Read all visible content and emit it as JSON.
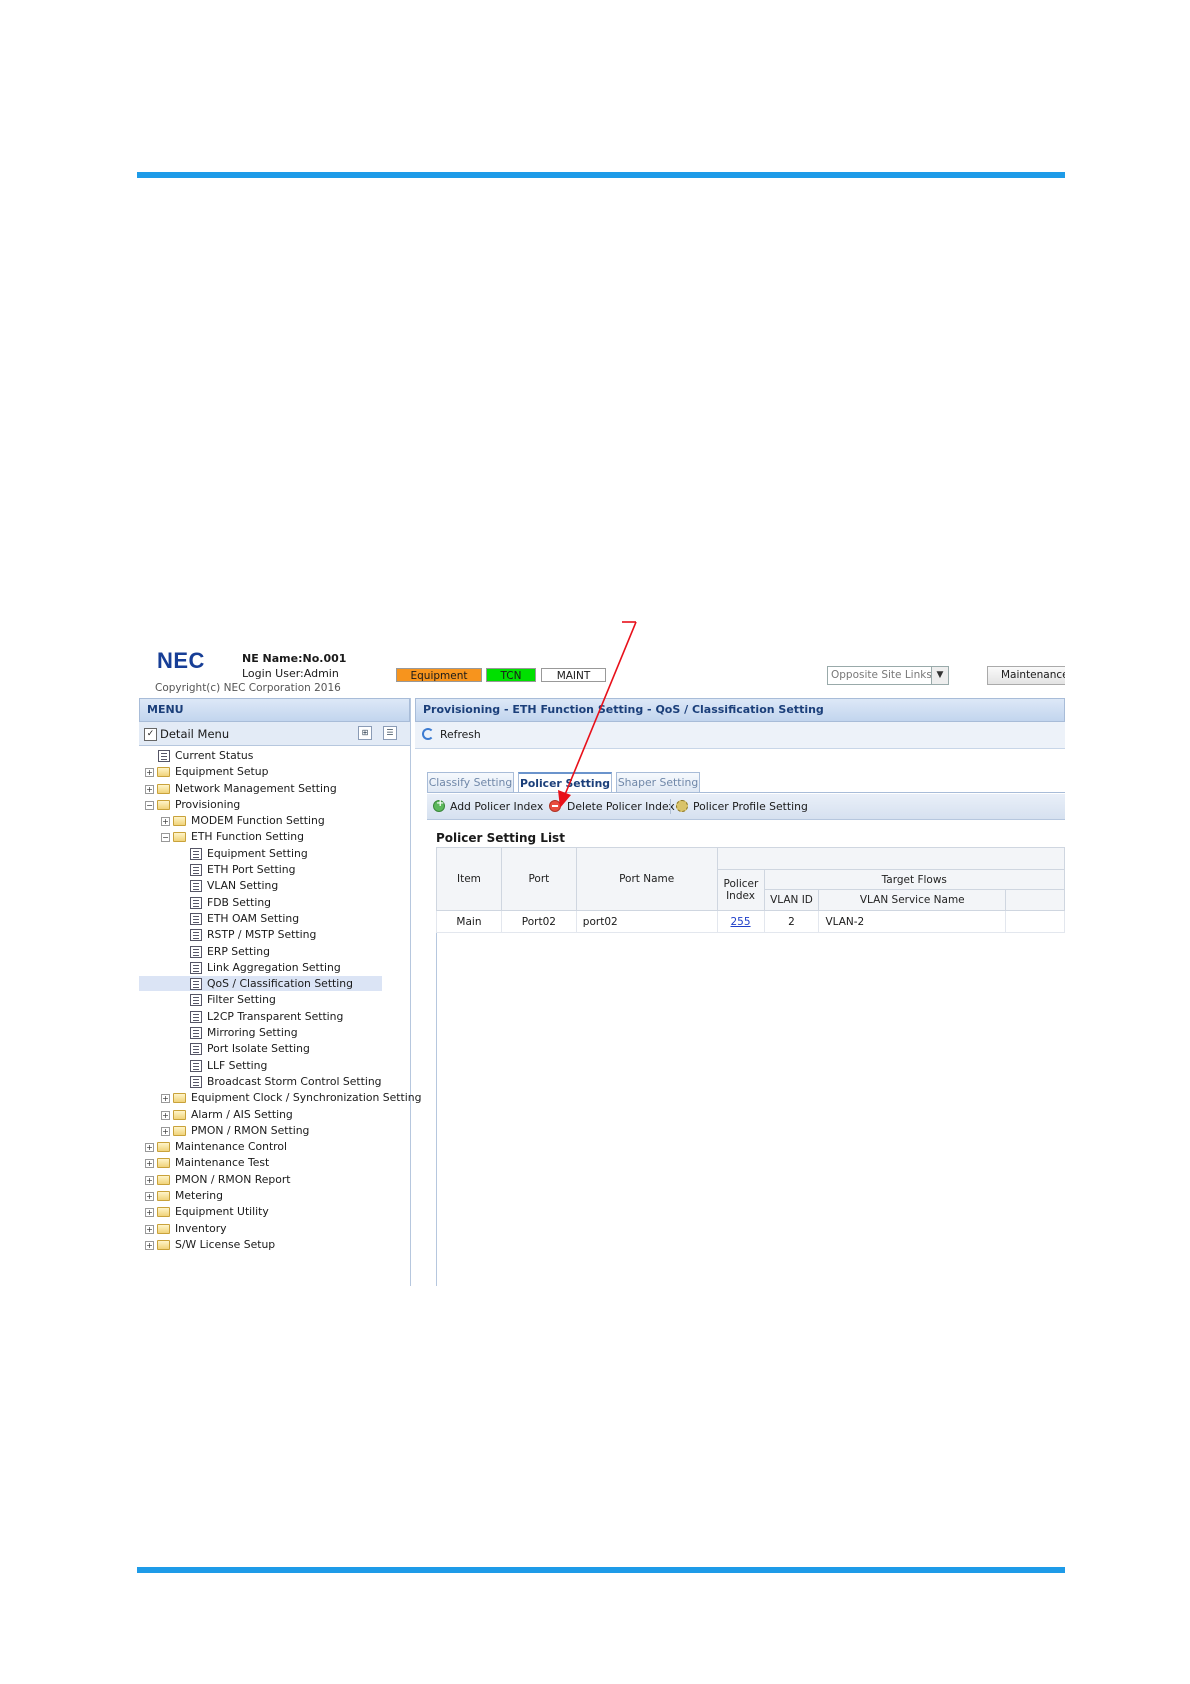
{
  "header": {
    "logo": "NEC",
    "ne_name": "NE Name:No.001",
    "login_user": "Login User:Admin",
    "copyright": "Copyright(c) NEC Corporation 2016",
    "status_badges": [
      {
        "label": "Equipment",
        "color": "#f7941d"
      },
      {
        "label": "TCN",
        "color": "#00e000"
      },
      {
        "label": "MAINT",
        "color": "#ffffff"
      }
    ],
    "opposite_site_select": "Opposite Site Links",
    "maintenance_button": "Maintenance"
  },
  "menu": {
    "title": "MENU",
    "detail_menu_label": "Detail Menu",
    "detail_menu_checked": true,
    "tree": [
      {
        "label": "Current Status",
        "level": 0,
        "type": "doc"
      },
      {
        "label": "Equipment Setup",
        "level": 0,
        "type": "folder",
        "expanded": false
      },
      {
        "label": "Network Management Setting",
        "level": 0,
        "type": "folder",
        "expanded": false
      },
      {
        "label": "Provisioning",
        "level": 0,
        "type": "folder",
        "expanded": true
      },
      {
        "label": "MODEM Function Setting",
        "level": 1,
        "type": "folder",
        "expanded": false
      },
      {
        "label": "ETH Function Setting",
        "level": 1,
        "type": "folder",
        "expanded": true
      },
      {
        "label": "Equipment Setting",
        "level": 2,
        "type": "doc"
      },
      {
        "label": "ETH Port Setting",
        "level": 2,
        "type": "doc"
      },
      {
        "label": "VLAN Setting",
        "level": 2,
        "type": "doc"
      },
      {
        "label": "FDB Setting",
        "level": 2,
        "type": "doc"
      },
      {
        "label": "ETH OAM Setting",
        "level": 2,
        "type": "doc"
      },
      {
        "label": "RSTP / MSTP Setting",
        "level": 2,
        "type": "doc"
      },
      {
        "label": "ERP Setting",
        "level": 2,
        "type": "doc"
      },
      {
        "label": "Link Aggregation Setting",
        "level": 2,
        "type": "doc"
      },
      {
        "label": "QoS / Classification Setting",
        "level": 2,
        "type": "doc",
        "selected": true
      },
      {
        "label": "Filter Setting",
        "level": 2,
        "type": "doc"
      },
      {
        "label": "L2CP Transparent Setting",
        "level": 2,
        "type": "doc"
      },
      {
        "label": "Mirroring Setting",
        "level": 2,
        "type": "doc"
      },
      {
        "label": "Port Isolate Setting",
        "level": 2,
        "type": "doc"
      },
      {
        "label": "LLF Setting",
        "level": 2,
        "type": "doc"
      },
      {
        "label": "Broadcast Storm Control Setting",
        "level": 2,
        "type": "doc"
      },
      {
        "label": "Equipment Clock / Synchronization Setting",
        "level": 1,
        "type": "folder",
        "expanded": false
      },
      {
        "label": "Alarm / AIS Setting",
        "level": 1,
        "type": "folder",
        "expanded": false
      },
      {
        "label": "PMON / RMON Setting",
        "level": 1,
        "type": "folder",
        "expanded": false
      },
      {
        "label": "Maintenance Control",
        "level": 0,
        "type": "folder",
        "expanded": false
      },
      {
        "label": "Maintenance Test",
        "level": 0,
        "type": "folder",
        "expanded": false
      },
      {
        "label": "PMON / RMON Report",
        "level": 0,
        "type": "folder",
        "expanded": false
      },
      {
        "label": "Metering",
        "level": 0,
        "type": "folder",
        "expanded": false
      },
      {
        "label": "Equipment Utility",
        "level": 0,
        "type": "folder",
        "expanded": false
      },
      {
        "label": "Inventory",
        "level": 0,
        "type": "folder",
        "expanded": false
      },
      {
        "label": "S/W License Setup",
        "level": 0,
        "type": "folder",
        "expanded": false
      }
    ]
  },
  "main": {
    "breadcrumb": "Provisioning - ETH Function Setting - QoS / Classification Setting",
    "refresh_label": "Refresh",
    "tabs": [
      {
        "label": "Classify Setting",
        "active": false
      },
      {
        "label": "Policer Setting",
        "active": true
      },
      {
        "label": "Shaper Setting",
        "active": false
      }
    ],
    "toolbar": {
      "add": "Add Policer Index",
      "delete": "Delete Policer Index",
      "profile": "Policer Profile Setting"
    },
    "list_title": "Policer Setting List",
    "table": {
      "headers": {
        "item": "Item",
        "port": "Port",
        "port_name": "Port Name",
        "policer_index": "Policer Index",
        "target_flows": "Target Flows",
        "vlan_id": "VLAN ID",
        "vlan_service_name": "VLAN Service Name"
      },
      "rows": [
        {
          "item": "Main",
          "port": "Port02",
          "port_name": "port02",
          "policer_index": "255",
          "vlan_id": "2",
          "vlan_service_name": "VLAN-2"
        }
      ]
    }
  },
  "annotation": {
    "arrow_color": "#e8101a"
  }
}
